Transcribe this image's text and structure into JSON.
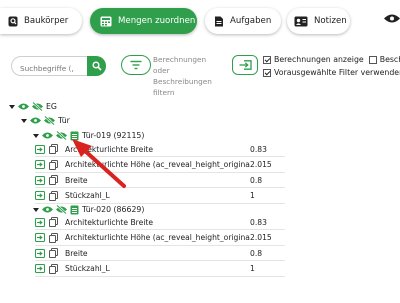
{
  "toolbar": {
    "baukoerper_label": "Baukörper",
    "mengen_label": "Mengen zuordnen",
    "aufgaben_label": "Aufgaben",
    "notizen_label": "Notizen"
  },
  "filter": {
    "search_placeholder": "Suchbegriffe (,",
    "filter_hint": "Berechnungen oder Beschreibungen filtern",
    "checkbox_berechnungen": "Berechnungen anzeige",
    "checkbox_besch": "Besch",
    "checkbox_vorausgewaehlt": "Vorausgewählte Filter verwender"
  },
  "tree": {
    "eg_label": "EG",
    "tuer_label": "Tür",
    "tuer019_label": "Tür-019 (92115)",
    "tuer020_label": "Tür-020 (86629)",
    "tuer019_rows": [
      {
        "name": "Architekturlichte Breite",
        "value": "0.83"
      },
      {
        "name": "Architekturlichte Höhe (ac_reveal_height_original)",
        "value": "2.015"
      },
      {
        "name": "Breite",
        "value": "0.8"
      },
      {
        "name": "Stückzahl_L",
        "value": "1"
      }
    ],
    "tuer020_rows": [
      {
        "name": "Architekturlichte Breite",
        "value": "0.83"
      },
      {
        "name": "Architekturlichte Höhe (ac_reveal_height_original)",
        "value": "2.015"
      },
      {
        "name": "Breite",
        "value": "0.8"
      },
      {
        "name": "Stückzahl_L",
        "value": "1"
      }
    ]
  },
  "colors": {
    "accent": "#2f9f4c",
    "annotation_arrow": "#d9231f"
  }
}
